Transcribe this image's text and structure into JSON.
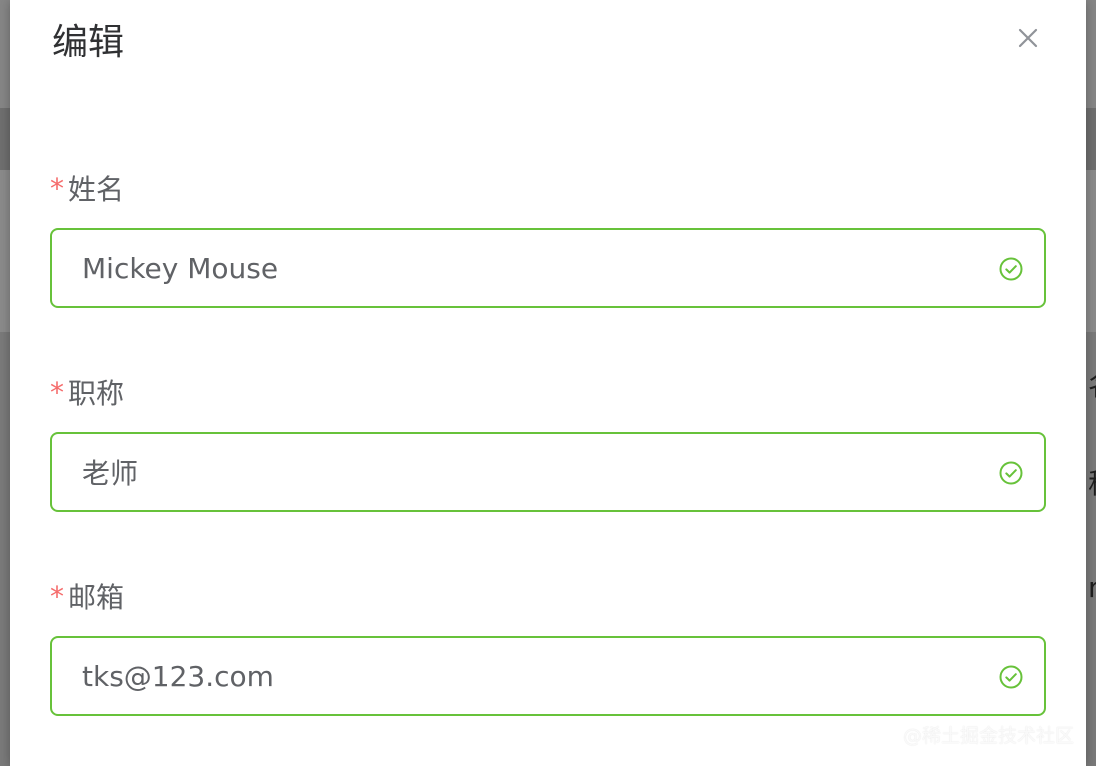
{
  "dialog": {
    "title": "编辑",
    "close_icon": "close-icon"
  },
  "form": {
    "required_mark": "*",
    "success_icon": "check-circle-icon",
    "fields": [
      {
        "label": "姓名",
        "value": "Mickey Mouse",
        "status": "success"
      },
      {
        "label": "职称",
        "value": "老师",
        "status": "success"
      },
      {
        "label": "邮箱",
        "value": "tks@123.com",
        "status": "success"
      }
    ]
  },
  "background": {
    "fragments": [
      "名",
      "称",
      "m"
    ]
  },
  "watermark": "@稀土掘金技术社区",
  "colors": {
    "success_border": "#67c23a",
    "required_mark": "#f56c6c",
    "title_text": "#303133",
    "input_text": "#606266"
  }
}
